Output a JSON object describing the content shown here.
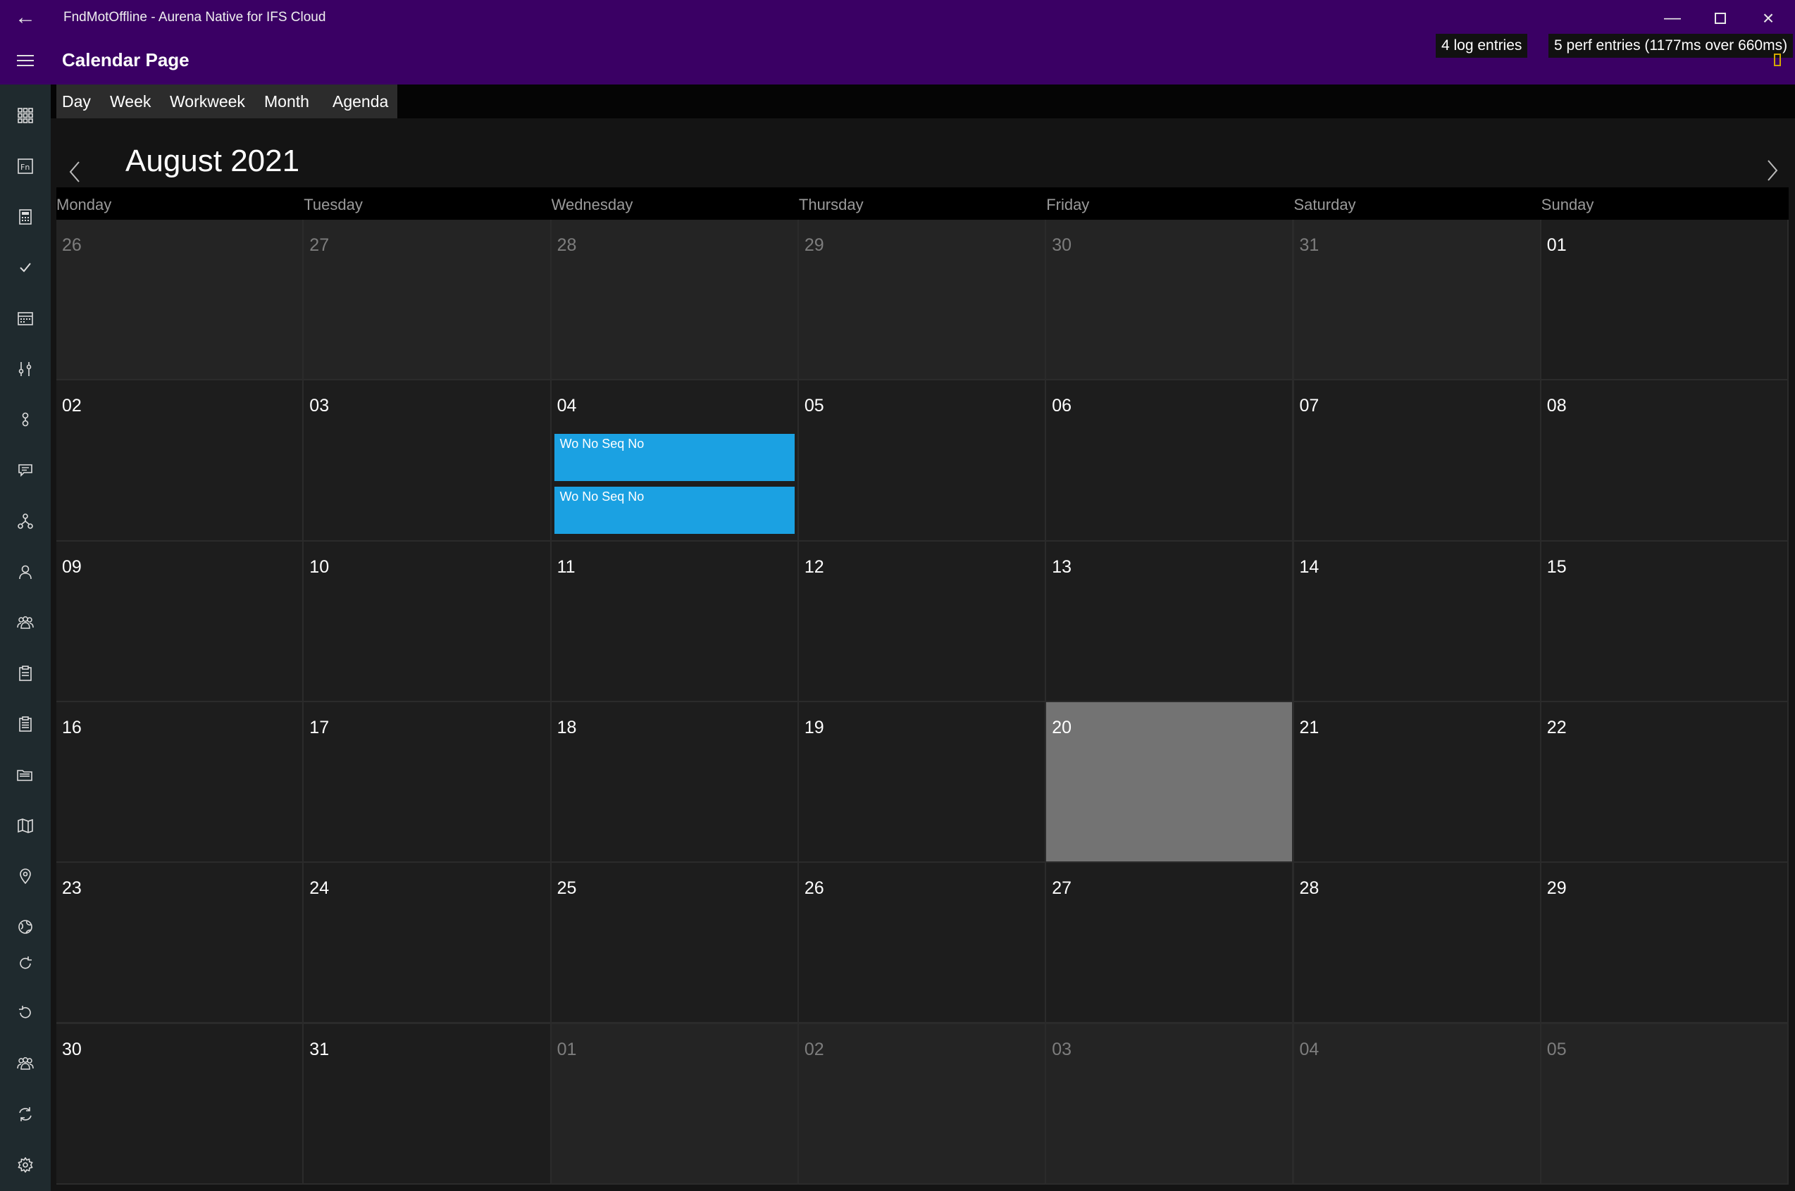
{
  "window": {
    "title": "FndMotOffline - Aurena Native for IFS Cloud",
    "back_icon": "arrow-left-icon",
    "minimize_icon": "minimize-icon",
    "maximize_icon": "maximize-icon",
    "close_icon": "close-icon"
  },
  "header": {
    "page_title": "Calendar Page",
    "log_badge": "4 log entries",
    "perf_badge": "5 perf entries (1177ms over 660ms)"
  },
  "sidebar": {
    "icons": [
      "apps-grid-icon",
      "fn-icon",
      "calculator-icon",
      "checkmark-icon",
      "calendar-icon",
      "sliders-icon",
      "key-icon",
      "chat-icon",
      "network-icon",
      "person-icon",
      "group-icon",
      "clipboard-icon",
      "clipboard-list-icon",
      "folder-icon",
      "map-icon",
      "location-pin-icon",
      "globe-icon",
      "sync-icon",
      "history-icon",
      "team-icon",
      "refresh-icon",
      "settings-icon"
    ]
  },
  "tabs": [
    {
      "label": "Day"
    },
    {
      "label": "Week"
    },
    {
      "label": "Workweek"
    },
    {
      "label": "Month"
    },
    {
      "label": "Agenda"
    }
  ],
  "calendar": {
    "month_title": "August 2021",
    "weekdays": [
      "Monday",
      "Tuesday",
      "Wednesday",
      "Thursday",
      "Friday",
      "Saturday",
      "Sunday"
    ],
    "weeks": [
      [
        {
          "d": "26",
          "other": true
        },
        {
          "d": "27",
          "other": true
        },
        {
          "d": "28",
          "other": true
        },
        {
          "d": "29",
          "other": true
        },
        {
          "d": "30",
          "other": true
        },
        {
          "d": "31",
          "other": true
        },
        {
          "d": "01",
          "other": false
        }
      ],
      [
        {
          "d": "02"
        },
        {
          "d": "03"
        },
        {
          "d": "04",
          "events": [
            "Wo No Seq No",
            "Wo No Seq No"
          ]
        },
        {
          "d": "05"
        },
        {
          "d": "06"
        },
        {
          "d": "07"
        },
        {
          "d": "08"
        }
      ],
      [
        {
          "d": "09"
        },
        {
          "d": "10"
        },
        {
          "d": "11"
        },
        {
          "d": "12"
        },
        {
          "d": "13"
        },
        {
          "d": "14"
        },
        {
          "d": "15"
        }
      ],
      [
        {
          "d": "16"
        },
        {
          "d": "17"
        },
        {
          "d": "18"
        },
        {
          "d": "19"
        },
        {
          "d": "20",
          "today": true
        },
        {
          "d": "21"
        },
        {
          "d": "22"
        }
      ],
      [
        {
          "d": "23"
        },
        {
          "d": "24"
        },
        {
          "d": "25"
        },
        {
          "d": "26"
        },
        {
          "d": "27"
        },
        {
          "d": "28"
        },
        {
          "d": "29"
        }
      ],
      [
        {
          "d": "30"
        },
        {
          "d": "31"
        },
        {
          "d": "01",
          "other": true
        },
        {
          "d": "02",
          "other": true
        },
        {
          "d": "03",
          "other": true
        },
        {
          "d": "04",
          "other": true
        },
        {
          "d": "05",
          "other": true
        }
      ]
    ]
  },
  "colors": {
    "titlebar": "#3a0064",
    "event": "#1ba1e2",
    "today": "#737373"
  }
}
